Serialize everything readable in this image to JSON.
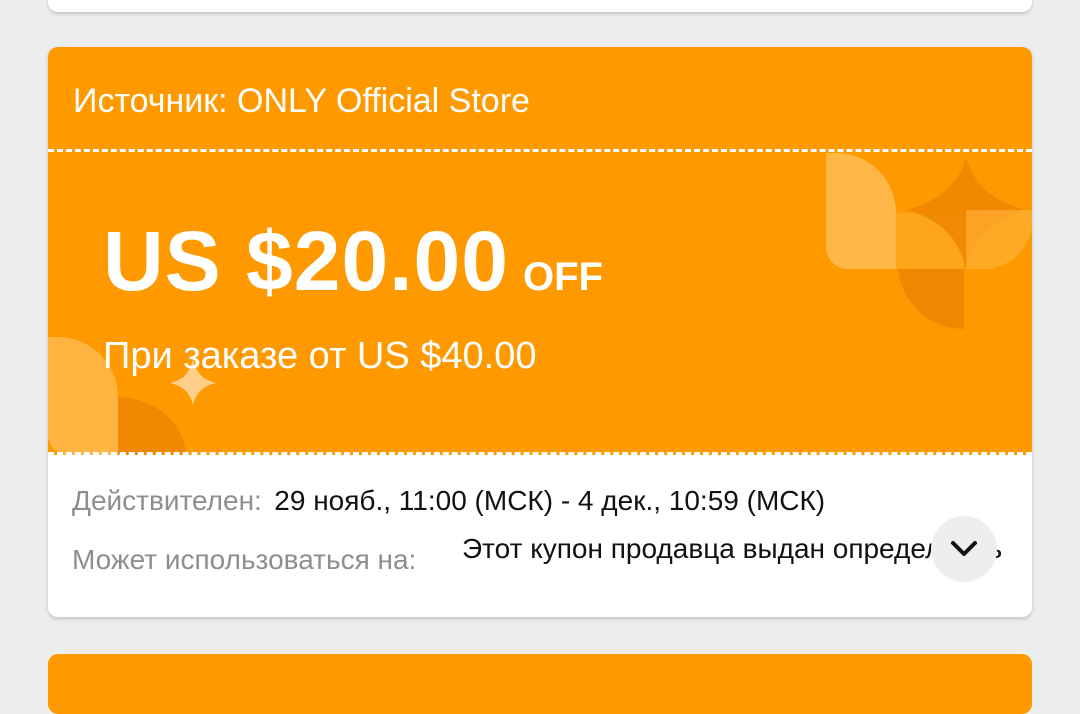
{
  "coupon": {
    "source": "Источник: ONLY Official Store",
    "amount": "US $20.00",
    "off_label": "OFF",
    "min_order": "При заказе от US $40.00",
    "validity_label": "Действителен:",
    "validity_value": "29 нояб., 11:00 (МСК) - 4 дек., 10:59 (МСК)",
    "usage_label": "Может использоваться на:",
    "usage_value": "Этот купон продавца выдан определенным",
    "expand_icon": "chevron-down-icon"
  },
  "colors": {
    "coupon_orange": "#fe9900",
    "background": "#eceeed",
    "label_gray": "#8e8e8e",
    "text_dark": "#111111"
  }
}
